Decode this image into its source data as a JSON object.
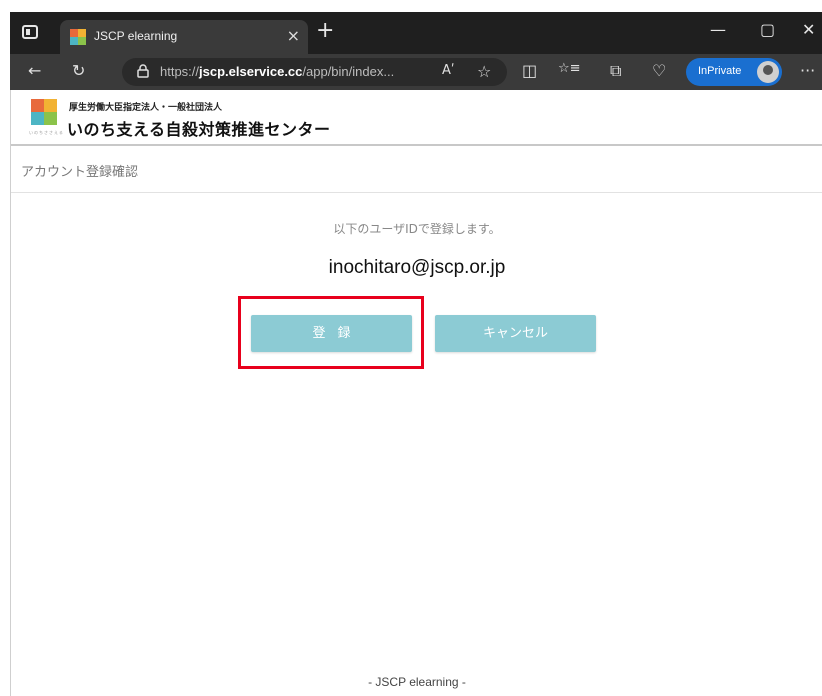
{
  "browser": {
    "tab_title": "JSCP elearning",
    "tab_close": "×",
    "new_tab": "+",
    "minimize": "—",
    "maximize": "▢",
    "close": "✕",
    "back": "←",
    "reload": "↻",
    "url_prefix": "https://",
    "url_domain": "jscp.elservice.cc",
    "url_path": "/app/bin/index...",
    "read_aloud": "Aʹ",
    "favorite": "☆",
    "split": "◫",
    "favorites_list": "☆≡",
    "collections": "⧉",
    "browser_essentials": "♡",
    "inprivate_label": "InPrivate",
    "menu": "···"
  },
  "site": {
    "org_line1": "厚生労働大臣指定法人・一般社団法人",
    "org_line2": "いのち支える自殺対策推進センター",
    "logo_sub": "いのちささえる",
    "logo_colors": [
      "#e86a3c",
      "#f2b233",
      "#4db5c4",
      "#8bc34a"
    ]
  },
  "main": {
    "page_title": "アカウント登録確認",
    "message": "以下のユーザIDで登録します。",
    "user_id": "inochitaro@jscp.or.jp",
    "register_label": "登録",
    "cancel_label": "キャンセル"
  },
  "footer": {
    "text": "- JSCP elearning -"
  },
  "colors": {
    "button": "#8ccbd4",
    "highlight": "#e8001c",
    "inprivate": "#1a6fd0"
  }
}
